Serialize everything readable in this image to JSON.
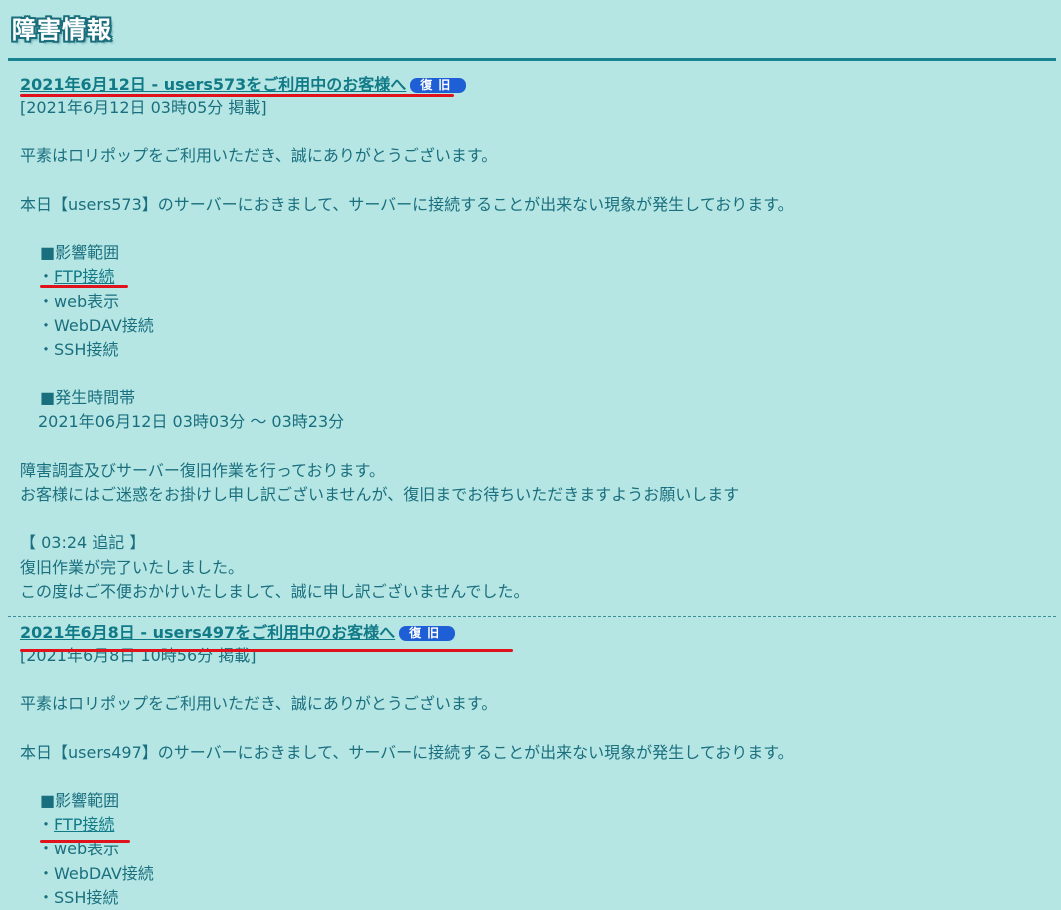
{
  "header": {
    "title": "障害情報"
  },
  "entries": [
    {
      "title": "2021年6月12日 - users573をご利用中のお客様へ",
      "status": "復旧",
      "posted": "[2021年6月12日 03時05分 掲載]",
      "greeting": "平素はロリポップをご利用いただき、誠にありがとうございます。",
      "notice": "本日【users573】のサーバーにおきまして、サーバーに接続することが出来ない現象が発生しております。",
      "scope_heading": "■影響範囲",
      "scope_items": [
        "FTP接続",
        "web表示",
        "WebDAV接続",
        "SSH接続"
      ],
      "time_heading": "■発生時間帯",
      "time_range": "2021年06月12日 03時03分 〜 03時23分",
      "work_1": "障害調査及びサーバー復旧作業を行っております。",
      "work_2": "お客様にはご迷惑をお掛けし申し訳ございませんが、復旧までお待ちいただきますようお願いします",
      "update_heading": "【 03:24 追記 】",
      "update_1": "復旧作業が完了いたしました。",
      "update_2": "この度はご不便おかけいたしまして、誠に申し訳ございませんでした。"
    },
    {
      "title": "2021年6月8日 - users497をご利用中のお客様へ",
      "status": "復旧",
      "posted": "[2021年6月8日 10時56分 掲載]",
      "greeting": "平素はロリポップをご利用いただき、誠にありがとうございます。",
      "notice": "本日【users497】のサーバーにおきまして、サーバーに接続することが出来ない現象が発生しております。",
      "scope_heading": "■影響範囲",
      "scope_items": [
        "FTP接続",
        "web表示",
        "WebDAV接続",
        "SSH接続"
      ]
    }
  ],
  "colors": {
    "background": "#b6e6e4",
    "text": "#1a6f7e",
    "link": "#117a87",
    "badge": "#1f5fd6",
    "annotation": "#e0121b"
  }
}
